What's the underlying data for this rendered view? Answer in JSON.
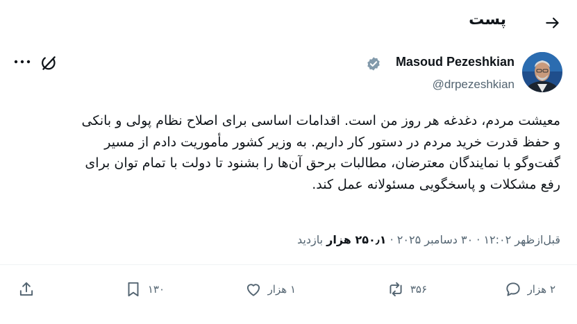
{
  "header": {
    "title": "پست"
  },
  "author": {
    "name": "Masoud Pezeshkian",
    "handle": "@drpezeshkian"
  },
  "post": {
    "lines": [
      "معیشت مردم، دغدغه هر روز من است. اقدامات اساسی برای اصلاح نظام پولی و بانکی",
      "و حفظ قدرت خرید مردم در دستور کار داریم. به وزیر کشور مأموریت دادم از مسیر",
      "گفت‌وگو با نمایندگان معترضان، مطالبات برحق آن‌ها را بشنود تا دولت با تمام توان برای",
      "رفع مشکلات و پاسخگویی مسئولانه عمل کند."
    ]
  },
  "meta": {
    "time": "قبل‌ازظهر ۱۲:۰۲",
    "dot": "·",
    "date": "۳۰ دسامبر ۲۰۲۵",
    "views": "۲۵۰٫۱ هزار",
    "views_label": "بازدید"
  },
  "actions": {
    "replies": "۲ هزار",
    "reposts": "۳۵۶",
    "likes": "۱ هزار",
    "bookmarks": "۱۳۰"
  },
  "icons": {
    "back": "arrow-right-icon",
    "more": "more-dots-icon",
    "grok": "grok-icon",
    "verified": "verified-badge-icon",
    "reply": "reply-icon",
    "repost": "repost-icon",
    "like": "heart-icon",
    "bookmark": "bookmark-icon",
    "share": "share-icon"
  },
  "colors": {
    "text": "#0f1419",
    "muted": "#536471",
    "badge": "#829aab",
    "divider": "#eff3f4"
  }
}
